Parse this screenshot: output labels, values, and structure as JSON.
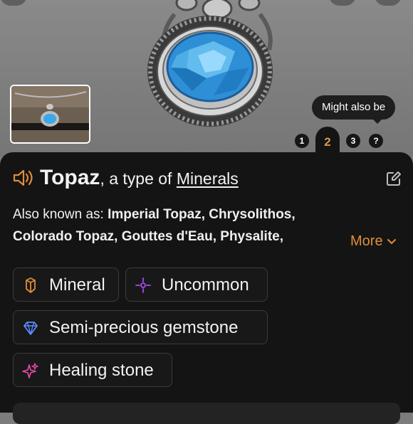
{
  "photo": {
    "thumbnail_alt": "pendant-thumbnail",
    "might_also_be": "Might also be"
  },
  "pager": {
    "pages": [
      "1",
      "2",
      "3",
      "?"
    ],
    "active_index": 1
  },
  "identification": {
    "name": "Topaz",
    "connector": ", a type of ",
    "category": "Minerals",
    "aka_label": "Also known as: ",
    "aka_line1": "Imperial Topaz, Chrysolithos,",
    "aka_line2": "Colorado Topaz, Gouttes d'Eau, Physalite,",
    "more_label": "More"
  },
  "tags": [
    {
      "label": "Mineral",
      "color": "#e08c3a"
    },
    {
      "label": "Uncommon",
      "color": "#a54cf0"
    },
    {
      "label": "Semi-precious gemstone",
      "color": "#5a8cff"
    },
    {
      "label": "Healing stone",
      "color": "#e84caa"
    }
  ],
  "colors": {
    "accent": "#e08c3a",
    "sheet_bg": "#141414"
  }
}
